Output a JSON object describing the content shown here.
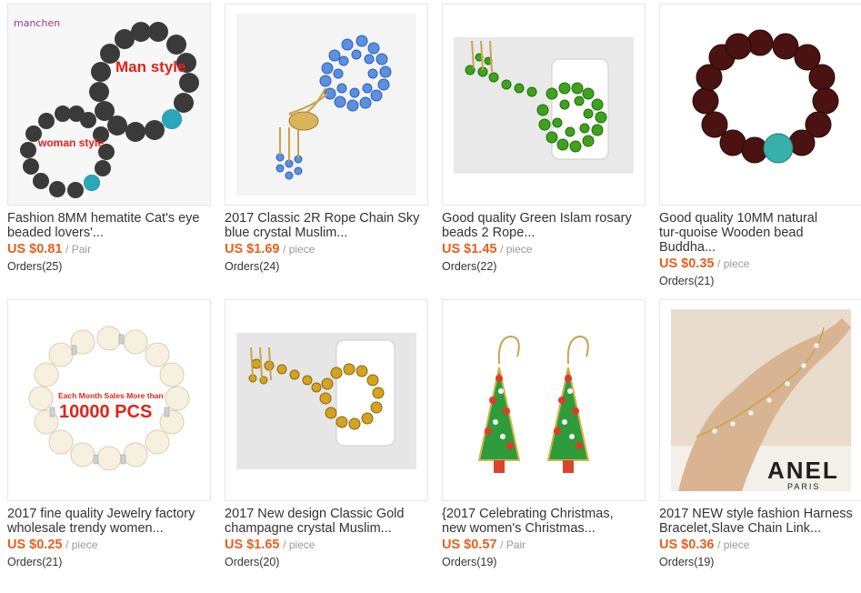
{
  "products": [
    {
      "title_line1": "Fashion 8MM hematite Cat's eye",
      "title_line2": "beaded lovers'...",
      "price": "US $0.81",
      "unit": "/ Pair",
      "orders": "Orders(25)",
      "image_labels": {
        "logo": "manchen",
        "man": "Man style",
        "woman": "woman style"
      }
    },
    {
      "title_line1": "2017 Classic 2R Rope Chain Sky",
      "title_line2": "blue crystal Muslim...",
      "price": "US $1.69",
      "unit": "/ piece",
      "orders": "Orders(24)"
    },
    {
      "title_line1": "Good quality Green Islam rosary",
      "title_line2": "beads 2 Rope...",
      "price": "US $1.45",
      "unit": "/ piece",
      "orders": "Orders(22)"
    },
    {
      "title_line1": "Good quality 10MM natural",
      "title_line2": "tur-quoise Wooden bead",
      "title_line3": "Buddha...",
      "price": "US $0.35",
      "unit": "/ piece",
      "orders": "Orders(21)"
    },
    {
      "title_line1": "2017 fine quality Jewelry factory",
      "title_line2": "wholesale trendy women...",
      "price": "US $0.25",
      "unit": "/ piece",
      "orders": "Orders(21)",
      "image_labels": {
        "banner_small": "Each Month Sales More than",
        "banner_big": "10000 PCS"
      }
    },
    {
      "title_line1": "2017 New design Classic Gold",
      "title_line2": "champagne crystal Muslim...",
      "price": "US $1.65",
      "unit": "/ piece",
      "orders": "Orders(20)"
    },
    {
      "title_line1": "{2017 Celebrating Christmas,",
      "title_line2": "new women's Christmas...",
      "price": "US $0.57",
      "unit": "/ Pair",
      "orders": "Orders(19)"
    },
    {
      "title_line1": "2017 NEW style fashion Harness",
      "title_line2": "Bracelet,Slave Chain Link...",
      "price": "US $0.36",
      "unit": "/ piece",
      "orders": "Orders(19)",
      "image_labels": {
        "sign_big": "ANEL",
        "sign_small": "PARIS"
      }
    }
  ],
  "colors": {
    "price": "#e8601d",
    "unit": "#999999",
    "title": "#333333",
    "border": "#e6e6e6"
  }
}
